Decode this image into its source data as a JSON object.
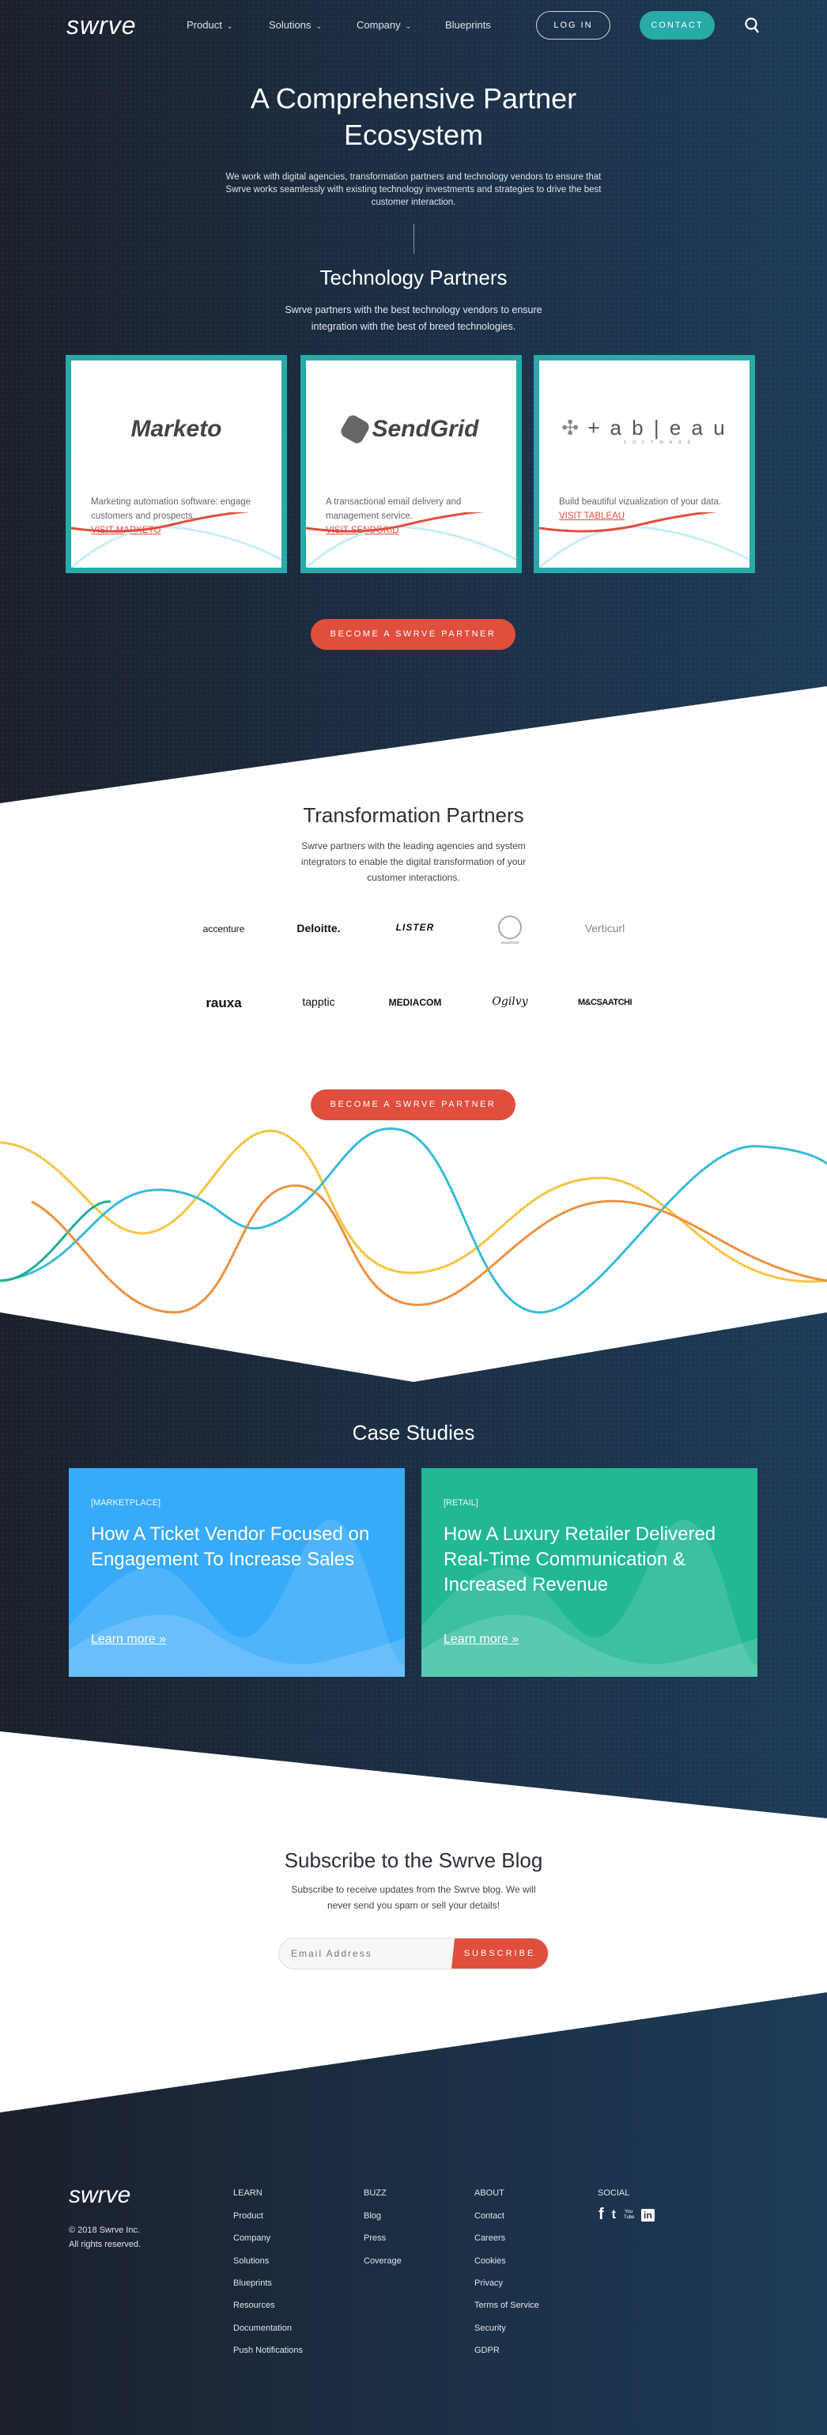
{
  "nav": {
    "logo": "swrve",
    "items": [
      {
        "label": "Product",
        "chevron": true
      },
      {
        "label": "Solutions",
        "chevron": true
      },
      {
        "label": "Company",
        "chevron": true
      },
      {
        "label": "Blueprints",
        "chevron": false
      }
    ],
    "login": "LOG IN",
    "contact": "CONTACT",
    "search_icon": "search-icon"
  },
  "hero": {
    "title_line1": "A Comprehensive Partner",
    "title_line2": "Ecosystem",
    "text": "We work with digital agencies, transformation partners and technology vendors to ensure that Swrve works seamlessly with existing technology investments and strategies to drive the best customer interaction."
  },
  "tech": {
    "title": "Technology Partners",
    "text": "Swrve partners with the best technology vendors to ensure integration with the best of breed technologies.",
    "cards": [
      {
        "logo": "Marketo",
        "desc": "Marketing automation software: engage customers and prospects.",
        "link": "VISIT MARKETO"
      },
      {
        "logo": "SendGrid",
        "desc": "A transactional email delivery and management service.",
        "link": "VISIT SENDGRID"
      },
      {
        "logo": "+ a b | e a u",
        "logo_sub": "SOFTWARE",
        "desc": "Build beautiful vizualization of your data.",
        "link": "VISIT TABLEAU"
      }
    ],
    "cta": "BECOME A SWRVE PARTNER"
  },
  "transform": {
    "title": "Transformation Partners",
    "text": "Swrve partners with the leading agencies and system integrators to enable the digital transformation of your customer interactions.",
    "logos": [
      "accenture",
      "Deloitte.",
      "LISTER",
      "showscott",
      "Verticurl",
      "rauxa",
      "tapptic",
      "MEDIACOM",
      "Ogilvy",
      "M&CSAATCHI"
    ],
    "cta": "BECOME A SWRVE PARTNER"
  },
  "cases": {
    "title": "Case Studies",
    "items": [
      {
        "tag": "[MARKETPLACE]",
        "title": "How A Ticket Vendor Focused on Engagement To Increase Sales",
        "link": "Learn more »",
        "color": "#38aafa"
      },
      {
        "tag": "[RETAIL]",
        "title": "How A Luxury Retailer Delivered Real-Time Communication & Increased Revenue",
        "link": "Learn more »",
        "color": "#22b894"
      }
    ]
  },
  "blog": {
    "title": "Subscribe to the Swrve Blog",
    "text": "Subscribe to receive updates from the Swrve blog. We will never send you spam or sell your details!",
    "placeholder": "Email Address",
    "button": "SUBSCRIBE"
  },
  "footer": {
    "logo": "swrve",
    "copyright": "© 2018 Swrve Inc.",
    "rights": "All rights reserved.",
    "columns": [
      {
        "title": "LEARN",
        "links": [
          "Product",
          "Company",
          "Solutions",
          "Blueprints",
          "Resources",
          "Documentation",
          "Push Notifications"
        ]
      },
      {
        "title": "BUZZ",
        "links": [
          "Blog",
          "Press",
          "Coverage"
        ]
      },
      {
        "title": "ABOUT",
        "links": [
          "Contact",
          "Careers",
          "Cookies",
          "Privacy",
          "Terms of Service",
          "Security",
          "GDPR"
        ]
      }
    ],
    "social_title": "SOCIAL",
    "social": [
      "f",
      "t",
      "You Tube",
      "in"
    ]
  },
  "colors": {
    "teal": "#27aaa8",
    "red": "#e04e3d",
    "dark": "#1c2d42"
  }
}
